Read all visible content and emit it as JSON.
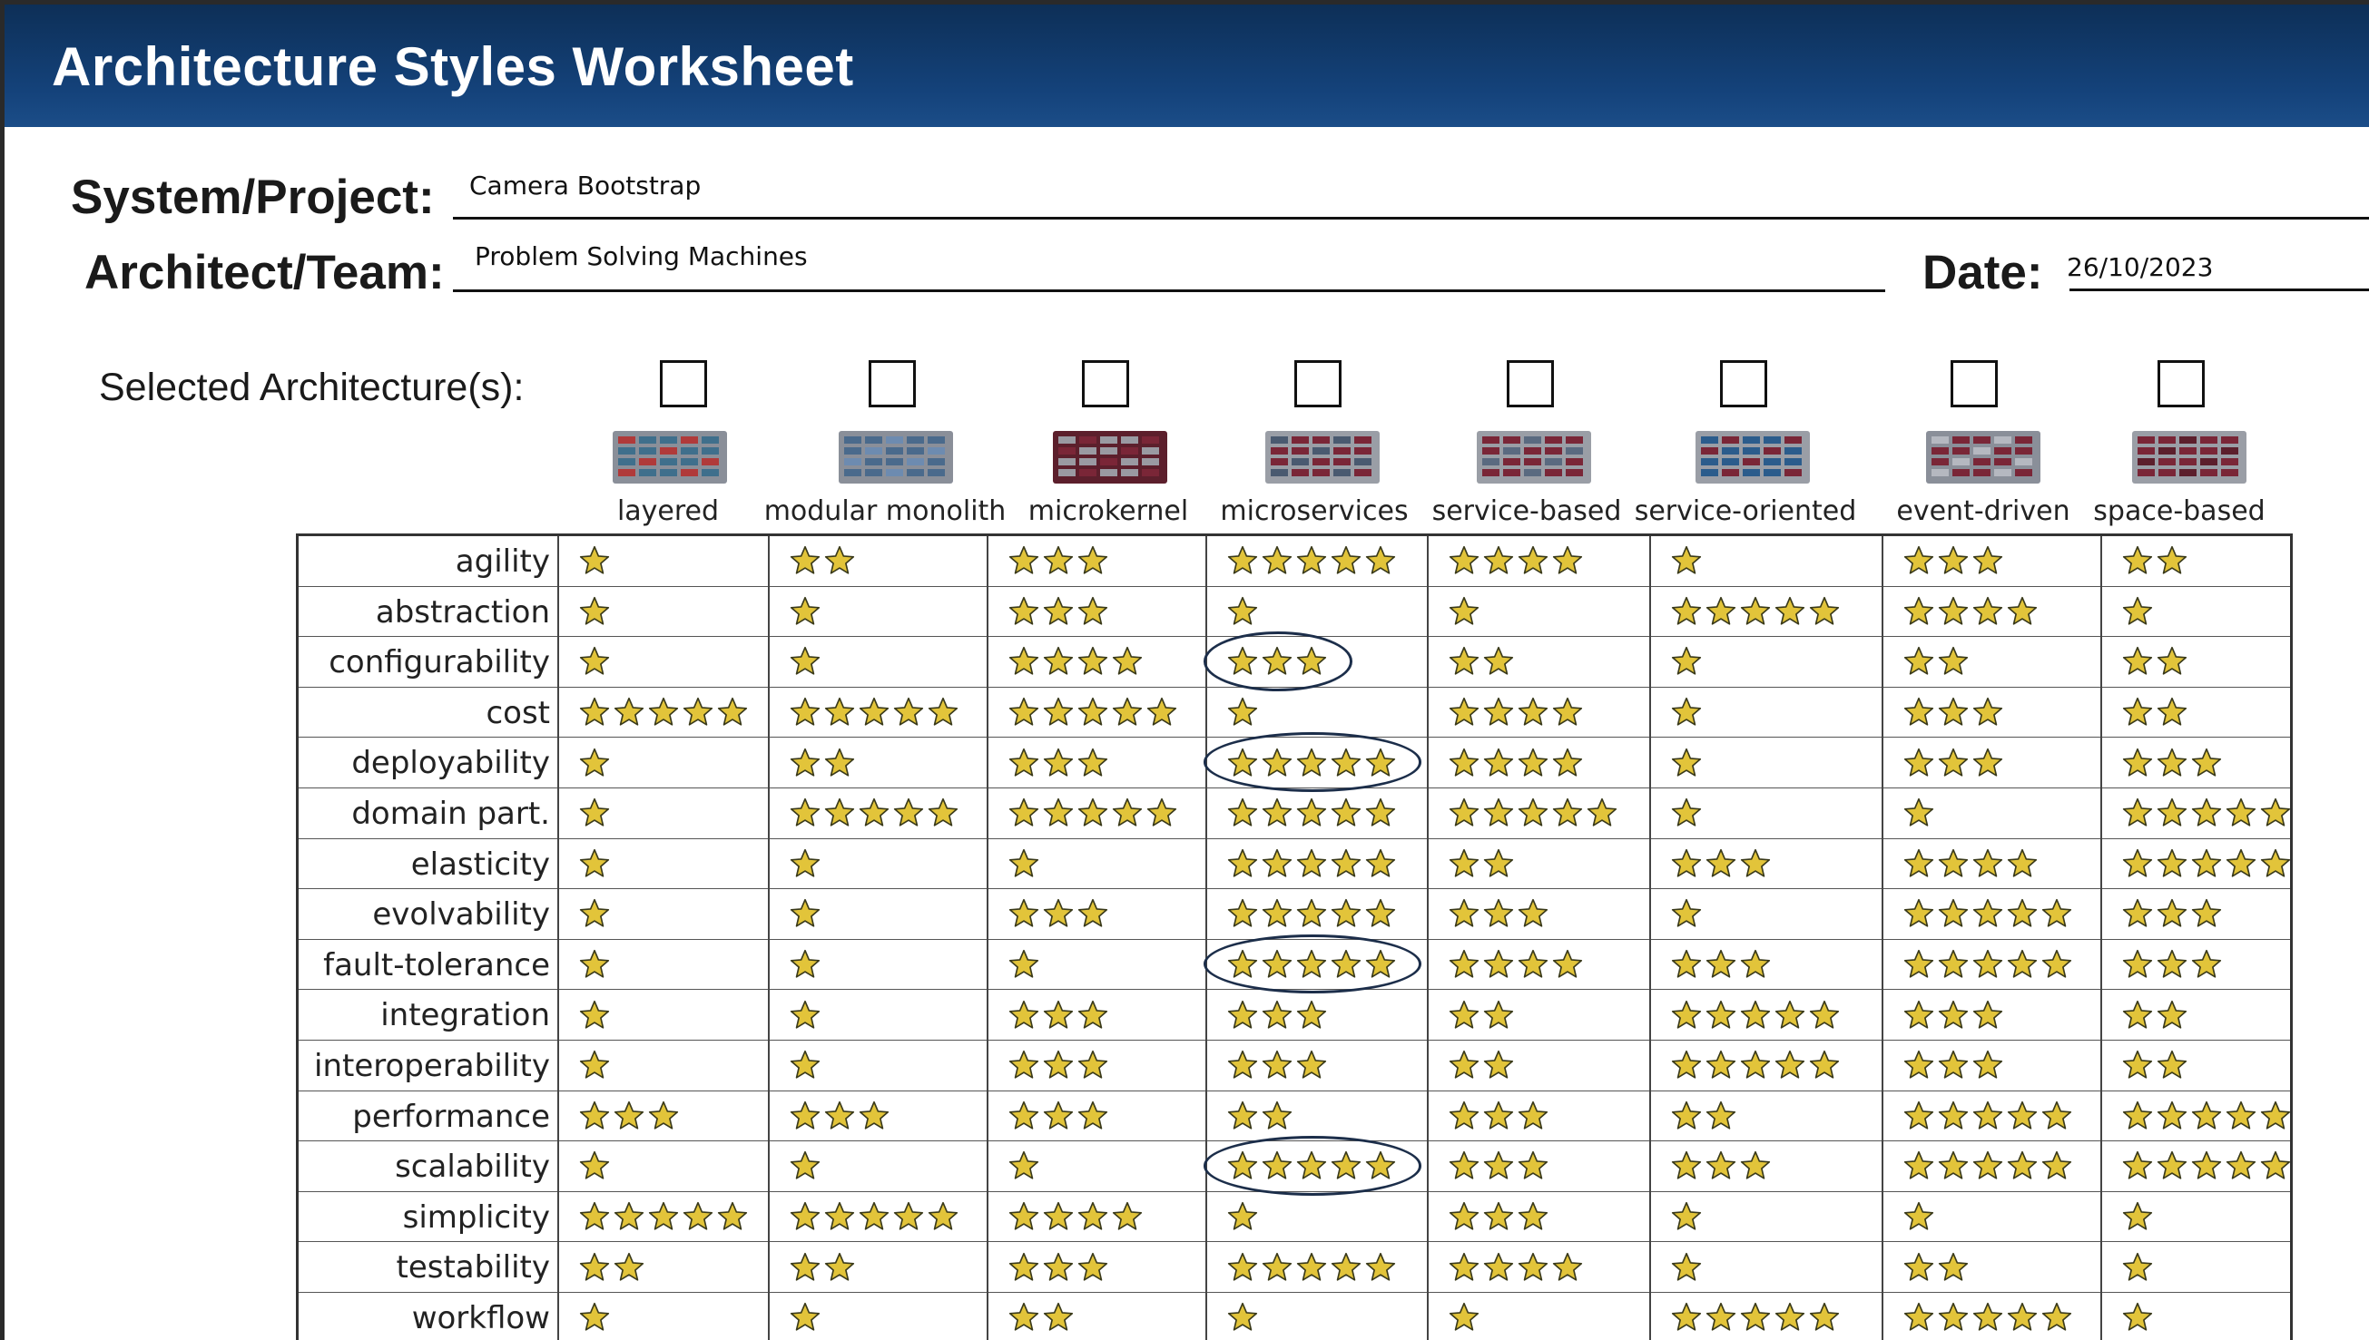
{
  "header": {
    "title": "Architecture Styles Worksheet"
  },
  "fields": {
    "system_label": "System/Project:",
    "system_value": "Camera Bootstrap",
    "architect_label": "Architect/Team:",
    "architect_value": "Problem Solving Machines",
    "date_label": "Date:",
    "date_value": "26/10/2023"
  },
  "selected_label": "Selected Architecture(s):",
  "architectures": [
    {
      "name": "layered",
      "selected": false,
      "icon": "layered-diagram-icon"
    },
    {
      "name": "modular monolith",
      "selected": false,
      "icon": "modular-monolith-diagram-icon"
    },
    {
      "name": "microkernel",
      "selected": false,
      "icon": "microkernel-diagram-icon"
    },
    {
      "name": "microservices",
      "selected": false,
      "icon": "microservices-diagram-icon"
    },
    {
      "name": "service-based",
      "selected": false,
      "icon": "service-based-diagram-icon"
    },
    {
      "name": "service-oriented",
      "selected": false,
      "icon": "service-oriented-diagram-icon"
    },
    {
      "name": "event-driven",
      "selected": false,
      "icon": "event-driven-diagram-icon"
    },
    {
      "name": "space-based",
      "selected": false,
      "icon": "space-based-diagram-icon"
    }
  ],
  "characteristics": [
    {
      "name": "agility",
      "ratings": [
        1,
        2,
        3,
        5,
        4,
        1,
        3,
        2
      ]
    },
    {
      "name": "abstraction",
      "ratings": [
        1,
        1,
        3,
        1,
        1,
        5,
        4,
        1
      ]
    },
    {
      "name": "configurability",
      "ratings": [
        1,
        1,
        4,
        3,
        2,
        1,
        2,
        2
      ]
    },
    {
      "name": "cost",
      "ratings": [
        5,
        5,
        5,
        1,
        4,
        1,
        3,
        2
      ]
    },
    {
      "name": "deployability",
      "ratings": [
        1,
        2,
        3,
        5,
        4,
        1,
        3,
        3
      ]
    },
    {
      "name": "domain part.",
      "ratings": [
        1,
        5,
        5,
        5,
        5,
        1,
        1,
        5
      ]
    },
    {
      "name": "elasticity",
      "ratings": [
        1,
        1,
        1,
        5,
        2,
        3,
        4,
        5
      ]
    },
    {
      "name": "evolvability",
      "ratings": [
        1,
        1,
        3,
        5,
        3,
        1,
        5,
        3
      ]
    },
    {
      "name": "fault-tolerance",
      "ratings": [
        1,
        1,
        1,
        5,
        4,
        3,
        5,
        3
      ]
    },
    {
      "name": "integration",
      "ratings": [
        1,
        1,
        3,
        3,
        2,
        5,
        3,
        2
      ]
    },
    {
      "name": "interoperability",
      "ratings": [
        1,
        1,
        3,
        3,
        2,
        5,
        3,
        2
      ]
    },
    {
      "name": "performance",
      "ratings": [
        3,
        3,
        3,
        2,
        3,
        2,
        5,
        5
      ]
    },
    {
      "name": "scalability",
      "ratings": [
        1,
        1,
        1,
        5,
        3,
        3,
        5,
        5
      ]
    },
    {
      "name": "simplicity",
      "ratings": [
        5,
        5,
        4,
        1,
        3,
        1,
        1,
        1
      ]
    },
    {
      "name": "testability",
      "ratings": [
        2,
        2,
        3,
        5,
        4,
        1,
        2,
        1
      ]
    },
    {
      "name": "workflow",
      "ratings": [
        1,
        1,
        2,
        1,
        1,
        5,
        5,
        1
      ]
    }
  ],
  "highlighted": [
    {
      "characteristic": "configurability",
      "architecture": "microservices"
    },
    {
      "characteristic": "deployability",
      "architecture": "microservices"
    },
    {
      "characteristic": "fault-tolerance",
      "architecture": "microservices"
    },
    {
      "characteristic": "scalability",
      "architecture": "microservices"
    }
  ],
  "icons": {
    "rating": "star-icon",
    "checkbox": "checkbox-icon"
  },
  "colors": {
    "header_bg": "#14427a",
    "star_fill": "#e2c43a",
    "star_stroke": "#3a3a1a",
    "highlight_circle": "#1c2e4a"
  }
}
